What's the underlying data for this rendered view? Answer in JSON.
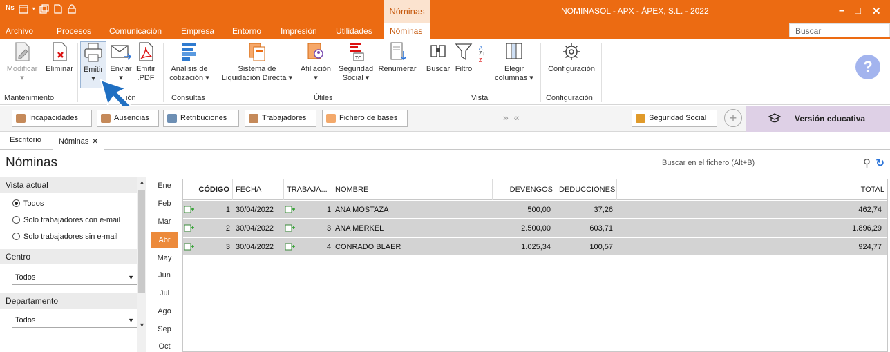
{
  "titlebar": {
    "app_logo": "Ns",
    "context_tab": "Nóminas",
    "window_title": "NOMINASOL - APX - ÁPEX, S.L. - 2022",
    "minimize": "–",
    "maximize": "□",
    "close": "✕"
  },
  "menu": {
    "items": [
      "Archivo",
      "Procesos",
      "Comunicación",
      "Empresa",
      "Entorno",
      "Impresión",
      "Utilidades",
      "Nóminas"
    ],
    "active": "Nóminas",
    "search_placeholder": "Buscar"
  },
  "ribbon": {
    "buttons": {
      "modificar": "Modificar",
      "eliminar": "Eliminar",
      "emitir": "Emitir",
      "enviar": "Enviar",
      "emitir_pdf_1": "Emitir",
      "emitir_pdf_2": ".PDF",
      "analisis_1": "Análisis de",
      "analisis_2": "cotización ▾",
      "sistema_1": "Sistema de",
      "sistema_2": "Liquidación Directa ▾",
      "afiliacion": "Afiliación",
      "seguridad_1": "Seguridad",
      "seguridad_2": "Social ▾",
      "renumerar": "Renumerar",
      "buscar": "Buscar",
      "filtro": "Filtro",
      "elegir_1": "Elegir",
      "elegir_2": "columnas ▾",
      "configuracion": "Configuración"
    },
    "groups": {
      "mantenimiento": "Mantenimiento",
      "emision": "ión",
      "consultas": "Consultas",
      "utiles": "Útiles",
      "vista": "Vista",
      "configuracion": "Configuración"
    },
    "help": "?"
  },
  "shortcuts": {
    "items": [
      "Incapacidades",
      "Ausencias",
      "Retribuciones",
      "Trabajadores",
      "Fichero de bases"
    ],
    "nav": "»  «",
    "seguridad_social": "Seguridad Social",
    "add": "+",
    "edu_label": "Versión educativa"
  },
  "doc_tabs": {
    "escritorio": "Escritorio",
    "nominas": "Nóminas",
    "close": "✕"
  },
  "page": {
    "title": "Nóminas",
    "search_placeholder": "Buscar en el fichero (Alt+B)"
  },
  "filters": {
    "vista_actual": "Vista actual",
    "options": [
      "Todos",
      "Solo trabajadores con e-mail",
      "Solo trabajadores sin e-mail"
    ],
    "selected_option": "Todos",
    "centro": "Centro",
    "centro_value": "Todos",
    "departamento": "Departamento",
    "departamento_value": "Todos"
  },
  "months": {
    "items": [
      "Ene",
      "Feb",
      "Mar",
      "Abr",
      "May",
      "Jun",
      "Jul",
      "Ago",
      "Sep",
      "Oct"
    ],
    "selected": "Abr"
  },
  "grid": {
    "headers": {
      "codigo": "CÓDIGO",
      "fecha": "FECHA",
      "trabajador": "TRABAJA...",
      "nombre": "NOMBRE",
      "devengos": "DEVENGOS",
      "deducciones": "DEDUCCIONES",
      "total": "TOTAL"
    },
    "rows": [
      {
        "codigo": "1",
        "fecha": "30/04/2022",
        "trabajador": "1",
        "nombre": "ANA MOSTAZA",
        "devengos": "500,00",
        "deducciones": "37,26",
        "total": "462,74"
      },
      {
        "codigo": "2",
        "fecha": "30/04/2022",
        "trabajador": "3",
        "nombre": "ANA MERKEL",
        "devengos": "2.500,00",
        "deducciones": "603,71",
        "total": "1.896,29"
      },
      {
        "codigo": "3",
        "fecha": "30/04/2022",
        "trabajador": "4",
        "nombre": "CONRADO BLAER",
        "devengos": "1.025,34",
        "deducciones": "100,57",
        "total": "924,77"
      }
    ]
  },
  "colors": {
    "accent": "#ec6b12",
    "selected_month": "#ec8a3b",
    "row_bg": "#d3d3d3",
    "edu_bg": "#ded0e6",
    "cursor_arrow": "#1f6fc2"
  }
}
